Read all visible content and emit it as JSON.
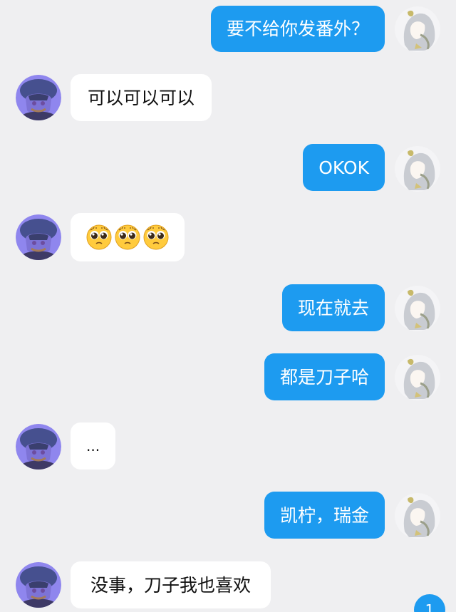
{
  "messages": [
    {
      "side": "right",
      "text": "要不给你发番外？"
    },
    {
      "side": "left",
      "text": "可以可以可以"
    },
    {
      "side": "right",
      "text": "OKOK"
    },
    {
      "side": "left",
      "emoji": [
        "pleading-face",
        "pleading-face",
        "pleading-face"
      ]
    },
    {
      "side": "right",
      "text": "现在就去"
    },
    {
      "side": "right",
      "text": "都是刀子哈"
    },
    {
      "side": "left",
      "text": "..."
    },
    {
      "side": "right",
      "text": "凯柠，瑞金"
    },
    {
      "side": "left",
      "text": "没事，刀子我也喜欢"
    }
  ],
  "unread_badge": {
    "count": "1"
  },
  "colors": {
    "background": "#efeff1",
    "outgoing_bubble": "#1d9bf0",
    "incoming_bubble": "#ffffff",
    "badge": "#1d9bf0"
  },
  "icons": {
    "self_avatar": "avatar-white-haired-character",
    "contact_avatar": "avatar-purple-beret-character",
    "emoji": "pleading-face"
  }
}
